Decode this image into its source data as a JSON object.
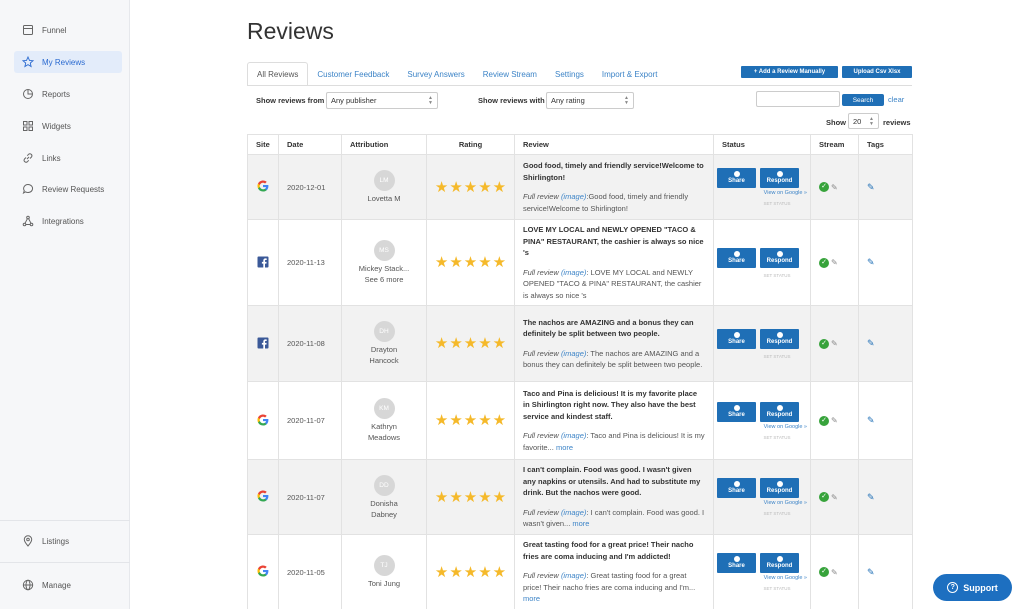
{
  "sidebar": {
    "items": [
      {
        "label": "Funnel",
        "icon": "funnel-icon"
      },
      {
        "label": "My Reviews",
        "icon": "star-icon"
      },
      {
        "label": "Reports",
        "icon": "reports-icon"
      },
      {
        "label": "Widgets",
        "icon": "widgets-icon"
      },
      {
        "label": "Links",
        "icon": "link-icon"
      },
      {
        "label": "Review Requests",
        "icon": "chat-icon"
      },
      {
        "label": "Integrations",
        "icon": "integrations-icon"
      }
    ],
    "bottom": [
      {
        "label": "Listings",
        "icon": "location-pin-icon"
      },
      {
        "label": "Manage",
        "icon": "globe-icon"
      }
    ]
  },
  "page": {
    "title": "Reviews"
  },
  "tabs": [
    "All Reviews",
    "Customer Feedback",
    "Survey Answers",
    "Review Stream",
    "Settings",
    "Import & Export"
  ],
  "actions": {
    "add_manual": "+ Add a Review Manually",
    "upload_csv": "Upload Csv Xlsx"
  },
  "filters": {
    "publisher_label": "Show reviews from",
    "publisher_value": "Any publisher",
    "rating_label": "Show reviews with",
    "rating_value": "Any rating",
    "search_button": "Search",
    "clear_link": "clear",
    "show_label": "Show",
    "show_value": "20",
    "reviews_label": "reviews"
  },
  "table": {
    "headers": [
      "Site",
      "Date",
      "Attribution",
      "Rating",
      "Review",
      "Status",
      "Stream",
      "Tags"
    ],
    "buttons": {
      "share": "Share",
      "respond": "Respond",
      "view_google": "View on Google »",
      "set_status": "SET STATUS"
    },
    "full_review_prefix": "Full review",
    "image_link": "(image)",
    "more_link": "more",
    "rows": [
      {
        "site": "google",
        "date": "2020-12-01",
        "initials": "LM",
        "attribution": "Lovetta M",
        "attribution2": "",
        "rating": 5,
        "title": "Good food, timely and friendly service!Welcome to Shirlington!",
        "full": ":Good food, timely and friendly service!Welcome to Shirlington!",
        "more": false
      },
      {
        "site": "facebook",
        "date": "2020-11-13",
        "initials": "MS",
        "attribution": "Mickey Stack...",
        "attribution2": "See 6 more",
        "rating": 5,
        "title": "LOVE MY LOCAL and NEWLY OPENED \"TACO & PINA\" RESTAURANT, the cashier is always so nice 's",
        "full": ": LOVE MY LOCAL and NEWLY OPENED \"TACO & PINA\" RESTAURANT, the cashier is always so nice 's",
        "more": false
      },
      {
        "site": "facebook",
        "date": "2020-11-08",
        "initials": "DH",
        "attribution": "Drayton",
        "attribution2": "Hancock",
        "rating": 5,
        "title": "The nachos are AMAZING and a bonus they can definitely be split between two people.",
        "full": ": The nachos are AMAZING and a bonus they can definitely be split between two people.",
        "more": false
      },
      {
        "site": "google",
        "date": "2020-11-07",
        "initials": "KM",
        "attribution": "Kathryn",
        "attribution2": "Meadows",
        "rating": 5,
        "title": "Taco and Pina is delicious! It is my favorite place in Shirlington right now. They also have the best service and kindest staff.",
        "full": ": Taco and Pina is delicious! It is my favorite...",
        "more": true
      },
      {
        "site": "google",
        "date": "2020-11-07",
        "initials": "DD",
        "attribution": "Donisha",
        "attribution2": "Dabney",
        "rating": 5,
        "title": "I can't complain. Food was good. I wasn't given any napkins or utensils. And had to substitute my drink. But the nachos were good.",
        "full": ": I can't complain. Food was good. I wasn't given...",
        "more": true
      },
      {
        "site": "google",
        "date": "2020-11-05",
        "initials": "TJ",
        "attribution": "Toni Jung",
        "attribution2": "",
        "rating": 5,
        "title": "Great tasting food for a great price! Their nacho fries are coma inducing and I'm addicted!",
        "full": ": Great tasting food for a great price! Their nacho fries are coma inducing and I'm...",
        "more": true
      }
    ]
  },
  "support": {
    "label": "Support"
  },
  "colors": {
    "accent": "#1f6fb6",
    "link": "#3d84c7",
    "star": "#f5b92a",
    "check": "#37a33b",
    "google_blue": "#4285F4",
    "facebook": "#3b5998"
  }
}
